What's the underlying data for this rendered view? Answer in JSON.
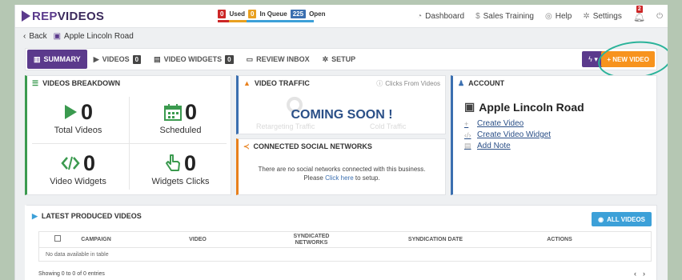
{
  "app": {
    "logo_rep": "REP",
    "logo_videos": "VIDEOS"
  },
  "queue": {
    "used_count": "0",
    "used_label": "Used",
    "queue_count": "0",
    "queue_label": "In Queue",
    "open_count": "225",
    "open_label": "Open",
    "colors": {
      "used": "#cc2727",
      "queue": "#e8a020",
      "open": "#3b6fb0"
    }
  },
  "nav": {
    "dashboard": "Dashboard",
    "sales_training": "Sales Training",
    "help": "Help",
    "settings": "Settings",
    "notifications": "2"
  },
  "breadcrumb": {
    "back": "Back",
    "location": "Apple Lincoln Road"
  },
  "tabs": [
    {
      "label": "SUMMARY",
      "icon": "chart-icon"
    },
    {
      "label": "VIDEOS",
      "count": "0",
      "icon": "play-icon"
    },
    {
      "label": "VIDEO WIDGETS",
      "count": "0",
      "icon": "widget-icon"
    },
    {
      "label": "REVIEW INBOX",
      "icon": "inbox-icon"
    },
    {
      "label": "SETUP",
      "icon": "gear-icon"
    }
  ],
  "actions": {
    "new_video": "+ NEW VIDEO"
  },
  "breakdown": {
    "title": "VIDEOS BREAKDOWN",
    "stats": [
      {
        "value": "0",
        "label": "Total Videos",
        "icon": "play-icon",
        "color": "#3b9a4f"
      },
      {
        "value": "0",
        "label": "Scheduled",
        "icon": "calendar-icon",
        "color": "#3b9a4f"
      },
      {
        "value": "0",
        "label": "Video Widgets",
        "icon": "code-icon",
        "color": "#3b9a4f"
      },
      {
        "value": "0",
        "label": "Widgets Clicks",
        "icon": "pointer-icon",
        "color": "#3b9a4f"
      }
    ]
  },
  "traffic": {
    "title": "VIDEO TRAFFIC",
    "note": "Clicks From Videos",
    "coming_soon": "COMING SOON !",
    "ghost_left": "Retargeting Traffic",
    "ghost_right": "Cold Traffic"
  },
  "social": {
    "title": "CONNECTED SOCIAL NETWORKS",
    "line1": "There are no social networks connected with this business.",
    "line2_pre": "Please ",
    "line2_link": "Click here",
    "line2_post": " to setup."
  },
  "account": {
    "title": "ACCOUNT",
    "name": "Apple Lincoln Road",
    "links": [
      "Create Video",
      "Create Video Widget",
      "Add Note"
    ]
  },
  "latest": {
    "title": "LATEST PRODUCED VIDEOS",
    "all_videos": "ALL VIDEOS",
    "columns": [
      "CAMPAIGN",
      "VIDEO",
      "SYNDICATED NETWORKS",
      "SYNDICATION DATE",
      "ACTIONS"
    ],
    "empty": "No data available in table",
    "info": "Showing 0 to 0 of 0 entries",
    "prev": "‹",
    "next": "›"
  }
}
